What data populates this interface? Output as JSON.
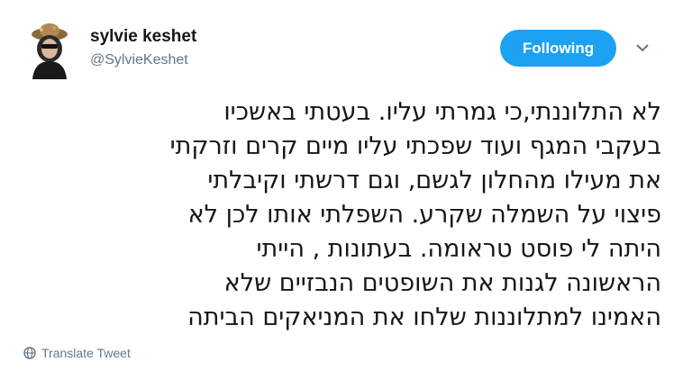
{
  "author": {
    "name": "sylvie keshet",
    "handle": "@SylvieKeshet"
  },
  "follow_button": {
    "label": "Following"
  },
  "icons": {
    "avatar": "profile-photo",
    "menu": "chevron-down-icon",
    "translate": "globe-icon"
  },
  "colors": {
    "accent": "#1da1f2",
    "secondary_text": "#657786",
    "text": "#14171a"
  },
  "tweet": {
    "lines": [
      "לא התלוננתי,כי גמרתי עליו. בעטתי באשכיו",
      "בעקבי המגף ועוד שפכתי עליו מיים קרים וזרקתי",
      "את מעילו מהחלון לגשם, וגם דרשתי וקיבלתי",
      "פיצוי על השמלה שקרע. השפלתי אותו לכן לא",
      "היתה לי פוסט טראומה. בעתונות , הייתי",
      "הראשונה לגנות את השופטים הנבזיים שלא",
      "האמינו למתלוננות שלחו את המניאקים הביתה"
    ]
  },
  "translate_link": {
    "label": "Translate Tweet"
  }
}
